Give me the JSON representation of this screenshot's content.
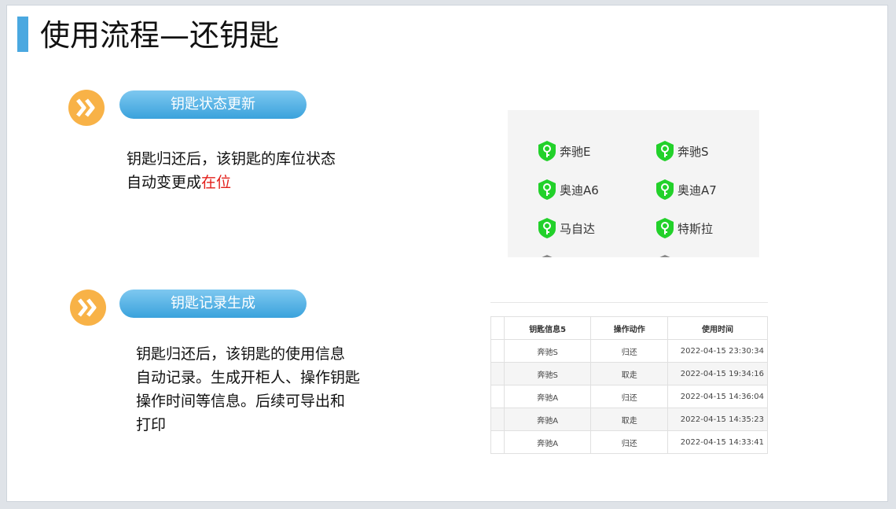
{
  "title": "使用流程—还钥匙",
  "sections": [
    {
      "badge": "钥匙状态更新",
      "lines": [
        "钥匙归还后，该钥匙的库位状态",
        "自动变更成"
      ],
      "highlight": "在位"
    },
    {
      "badge": "钥匙记录生成",
      "lines": [
        "钥匙归还后，该钥匙的使用信息",
        "自动记录。生成开柜人、操作钥匙",
        "操作时间等信息。后续可导出和",
        "打印"
      ]
    }
  ],
  "key_panel": {
    "keys": [
      "奔驰E",
      "奔驰S",
      "奥迪A6",
      "奥迪A7",
      "马自达",
      "特斯拉"
    ],
    "colors": {
      "active": "#22d12a",
      "inactive": "#888888"
    }
  },
  "records_table": {
    "headers": [
      "钥匙信息5",
      "操作动作",
      "使用时间"
    ],
    "rows": [
      [
        "奔驰S",
        "归还",
        "2022-04-15 23:30:34"
      ],
      [
        "奔驰S",
        "取走",
        "2022-04-15 19:34:16"
      ],
      [
        "奔驰A",
        "归还",
        "2022-04-15 14:36:04"
      ],
      [
        "奔驰A",
        "取走",
        "2022-04-15 14:35:23"
      ],
      [
        "奔驰A",
        "归还",
        "2022-04-15 14:33:41"
      ]
    ]
  },
  "colors": {
    "accent": "#4aa8e0",
    "badge": "#3aa2dc",
    "chevron": "#f8b247",
    "highlight": "#e3201b"
  }
}
